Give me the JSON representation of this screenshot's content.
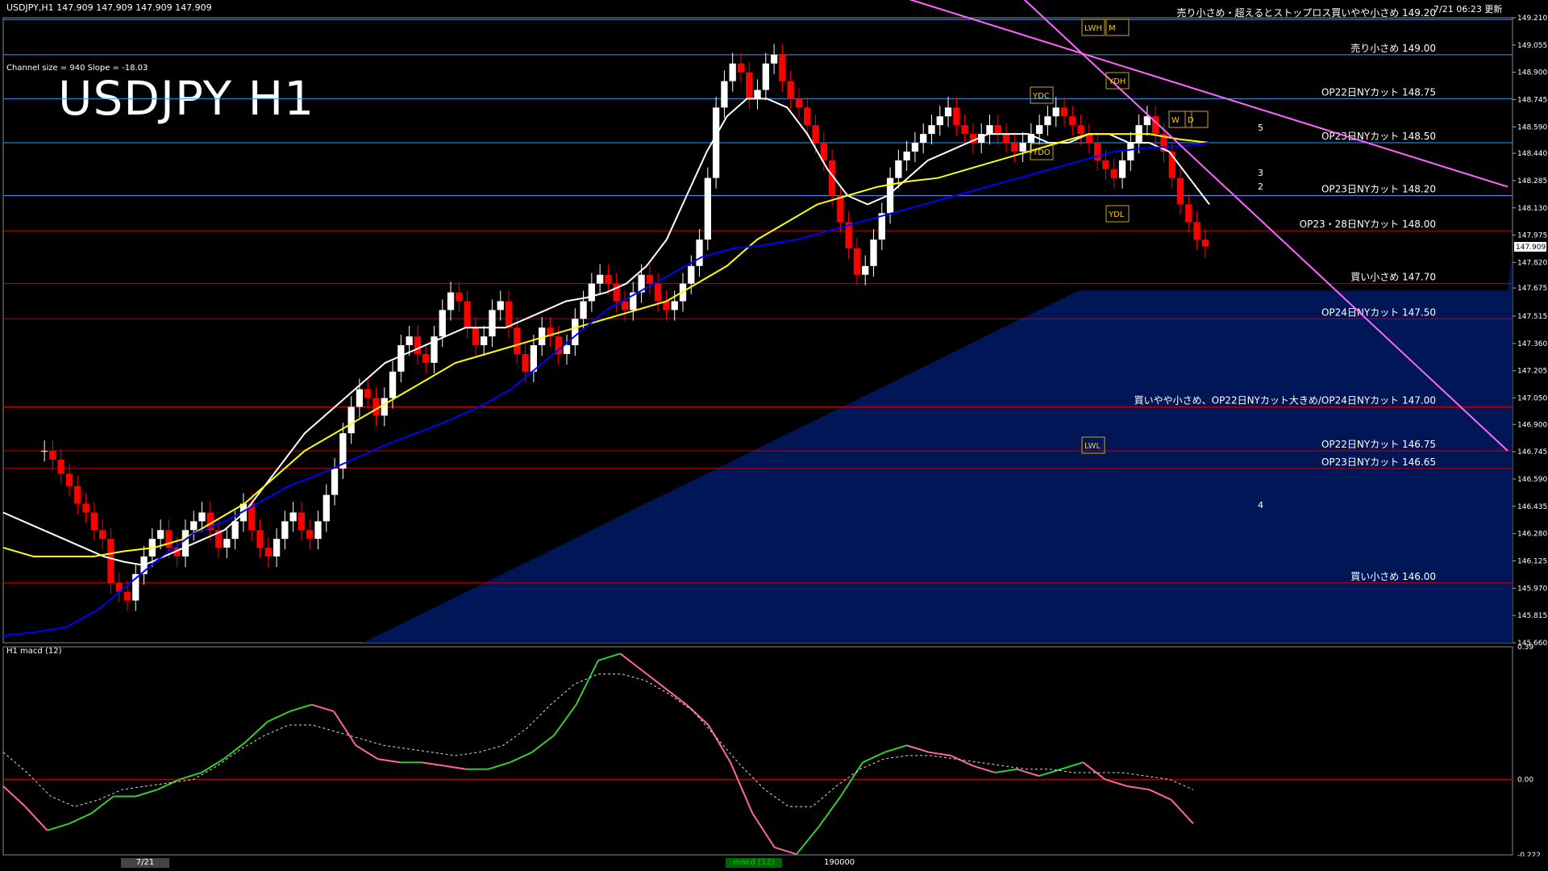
{
  "header": {
    "symbol_info": "USDJPY,H1  147.909 147.909 147.909 147.909",
    "datetime": "7/21 06:23 更新",
    "channel_info": "Channel size = 940 Slope = -18.03",
    "big_title": "USDJPY H1",
    "macd_title": "H1  macd (12)"
  },
  "colors": {
    "background": "#000000",
    "bull_candle": "#ffffff",
    "bear_candle": "#ff0000",
    "sma_fast": "#ffffff",
    "sma_mid": "#ffff00",
    "sma_slow": "#0000ff",
    "channel": "#ff66ff",
    "level_blue": "#3399ff",
    "level_red": "#cc0000",
    "macd_up": "#33cc33",
    "macd_down": "#ff6699"
  },
  "chart_data": [
    {
      "type": "line",
      "title": "USDJPY H1",
      "ylim": [
        145.66,
        149.21
      ],
      "yticks": [
        "149.210",
        "149.055",
        "148.900",
        "148.745",
        "148.590",
        "148.440",
        "148.285",
        "148.130",
        "147.975",
        "147.820",
        "147.675",
        "147.515",
        "147.360",
        "147.205",
        "147.050",
        "146.900",
        "146.745",
        "146.590",
        "146.435",
        "146.280",
        "146.125",
        "145.970",
        "145.815",
        "145.660"
      ],
      "current_price_label": "147.909",
      "close": [
        146.75,
        146.7,
        146.62,
        146.55,
        146.45,
        146.4,
        146.3,
        146.25,
        146.0,
        145.95,
        145.9,
        146.05,
        146.15,
        146.25,
        146.3,
        146.2,
        146.15,
        146.3,
        146.35,
        146.4,
        146.3,
        146.2,
        146.25,
        146.35,
        146.45,
        146.3,
        146.2,
        146.15,
        146.25,
        146.35,
        146.4,
        146.3,
        146.25,
        146.35,
        146.5,
        146.65,
        146.85,
        147.0,
        147.1,
        147.05,
        146.95,
        147.05,
        147.2,
        147.35,
        147.4,
        147.3,
        147.25,
        147.4,
        147.55,
        147.65,
        147.6,
        147.45,
        147.35,
        147.4,
        147.55,
        147.6,
        147.45,
        147.3,
        147.2,
        147.35,
        147.45,
        147.4,
        147.3,
        147.35,
        147.5,
        147.6,
        147.7,
        147.75,
        147.7,
        147.6,
        147.55,
        147.65,
        147.75,
        147.7,
        147.6,
        147.55,
        147.6,
        147.7,
        147.8,
        147.95,
        148.3,
        148.7,
        148.85,
        148.95,
        148.9,
        148.75,
        148.8,
        148.95,
        149.0,
        148.85,
        148.75,
        148.7,
        148.6,
        148.5,
        148.4,
        148.2,
        148.05,
        147.9,
        147.75,
        147.8,
        147.95,
        148.1,
        148.3,
        148.4,
        148.45,
        148.5,
        148.55,
        148.6,
        148.65,
        148.7,
        148.6,
        148.55,
        148.5,
        148.55,
        148.6,
        148.55,
        148.5,
        148.45,
        148.5,
        148.55,
        148.6,
        148.65,
        148.7,
        148.65,
        148.6,
        148.55,
        148.5,
        148.4,
        148.35,
        148.3,
        148.4,
        148.5,
        148.6,
        148.65,
        148.55,
        148.45,
        148.3,
        148.15,
        148.05,
        147.95,
        147.91
      ],
      "series": [
        {
          "name": "sma_fast",
          "values": [
            146.4,
            146.35,
            146.3,
            146.25,
            146.2,
            146.15,
            146.12,
            146.1,
            146.15,
            146.2,
            146.25,
            146.3,
            146.4,
            146.55,
            146.7,
            146.85,
            146.95,
            147.05,
            147.15,
            147.25,
            147.3,
            147.35,
            147.4,
            147.45,
            147.45,
            147.45,
            147.5,
            147.55,
            147.6,
            147.62,
            147.65,
            147.7,
            147.8,
            147.95,
            148.2,
            148.45,
            148.65,
            148.75,
            148.75,
            148.7,
            148.55,
            148.35,
            148.2,
            148.15,
            148.2,
            148.3,
            148.4,
            148.45,
            148.5,
            148.55,
            148.55,
            148.55,
            148.5,
            148.5,
            148.55,
            148.55,
            148.5,
            148.5,
            148.45,
            148.3,
            148.15
          ]
        },
        {
          "name": "sma_mid",
          "values": [
            146.2,
            146.15,
            146.15,
            146.15,
            146.18,
            146.2,
            146.25,
            146.35,
            146.45,
            146.6,
            146.75,
            146.85,
            146.95,
            147.05,
            147.15,
            147.25,
            147.3,
            147.35,
            147.4,
            147.45,
            147.5,
            147.55,
            147.6,
            147.7,
            147.8,
            147.95,
            148.05,
            148.15,
            148.2,
            148.25,
            148.28,
            148.3,
            148.35,
            148.4,
            148.45,
            148.5,
            148.55,
            148.55,
            148.55,
            148.52,
            148.5
          ]
        },
        {
          "name": "sma_slow",
          "values": [
            145.7,
            145.72,
            145.75,
            145.85,
            146.0,
            146.15,
            146.28,
            146.35,
            146.45,
            146.55,
            146.62,
            146.7,
            146.78,
            146.85,
            146.92,
            147.0,
            147.1,
            147.25,
            147.4,
            147.55,
            147.65,
            147.75,
            147.85,
            147.9,
            147.92,
            147.95,
            148.0,
            148.05,
            148.1,
            148.15,
            148.2,
            148.25,
            148.3,
            148.35,
            148.4,
            148.45,
            148.47,
            148.48,
            148.5
          ]
        },
        {
          "name": "channel_upper",
          "values": [
            149.9,
            148.25
          ]
        },
        {
          "name": "channel_lower",
          "values": [
            149.85,
            146.75
          ]
        }
      ],
      "levels": [
        {
          "price": 149.2,
          "color": "blue",
          "label": "売り小さめ・超えるとストップロス買いやや小さめ 149.20"
        },
        {
          "price": 149.0,
          "color": "blue",
          "label": "売り小さめ 149.00"
        },
        {
          "price": 148.75,
          "color": "blue",
          "label": "OP22日NYカット 148.75"
        },
        {
          "price": 148.5,
          "color": "blue",
          "label": "OP23日NYカット 148.50"
        },
        {
          "price": 148.2,
          "color": "blue",
          "label": "OP23日NYカット 148.20"
        },
        {
          "price": 148.0,
          "color": "red",
          "label": "OP23・28日NYカット 148.00"
        },
        {
          "price": 147.7,
          "color": "red",
          "label": "買い小さめ 147.70"
        },
        {
          "price": 147.5,
          "color": "red",
          "label": "OP24日NYカット 147.50"
        },
        {
          "price": 147.0,
          "color": "red",
          "label": "買いやや小さめ、OP22日NYカット大きめ/OP24日NYカット 147.00"
        },
        {
          "price": 146.75,
          "color": "red",
          "label": "OP22日NYカット 146.75"
        },
        {
          "price": 146.65,
          "color": "red",
          "label": "OP23日NYカット 146.65"
        },
        {
          "price": 146.0,
          "color": "red",
          "label": "買い小さめ 146.00"
        }
      ],
      "markers": [
        "YDC",
        "YDO",
        "YDH",
        "YDL",
        "LWH",
        "LWL",
        "W",
        "D",
        "M"
      ],
      "wave_labels": [
        "5",
        "3",
        "2",
        "4"
      ]
    },
    {
      "type": "line",
      "title": "H1  macd (12)",
      "ylim": [
        -0.222,
        0.39
      ],
      "yticks": [
        "0.39",
        "0.00",
        "-0.222"
      ],
      "series": [
        {
          "name": "macd",
          "values": [
            -0.02,
            -0.08,
            -0.15,
            -0.13,
            -0.1,
            -0.05,
            -0.05,
            -0.03,
            0.0,
            0.02,
            0.06,
            0.11,
            0.17,
            0.2,
            0.22,
            0.2,
            0.1,
            0.06,
            0.05,
            0.05,
            0.04,
            0.03,
            0.03,
            0.05,
            0.08,
            0.13,
            0.22,
            0.35,
            0.37,
            0.32,
            0.27,
            0.22,
            0.16,
            0.05,
            -0.1,
            -0.2,
            -0.22,
            -0.14,
            -0.05,
            0.05,
            0.08,
            0.1,
            0.08,
            0.07,
            0.04,
            0.02,
            0.03,
            0.01,
            0.03,
            0.05,
            0.0,
            -0.02,
            -0.03,
            -0.06,
            -0.13
          ]
        },
        {
          "name": "signal",
          "values": [
            0.08,
            0.02,
            -0.05,
            -0.08,
            -0.06,
            -0.03,
            -0.02,
            -0.01,
            0.0,
            0.04,
            0.09,
            0.13,
            0.16,
            0.16,
            0.14,
            0.12,
            0.1,
            0.09,
            0.08,
            0.07,
            0.08,
            0.1,
            0.15,
            0.22,
            0.28,
            0.31,
            0.31,
            0.29,
            0.25,
            0.2,
            0.12,
            0.04,
            -0.03,
            -0.08,
            -0.08,
            -0.02,
            0.03,
            0.06,
            0.07,
            0.07,
            0.06,
            0.05,
            0.04,
            0.03,
            0.03,
            0.02,
            0.02,
            0.02,
            0.01,
            0.0,
            -0.03
          ]
        }
      ]
    }
  ],
  "footer": {
    "date_tab": "7/21",
    "volume_label": "190000",
    "macd_tab": "macd (12)"
  }
}
